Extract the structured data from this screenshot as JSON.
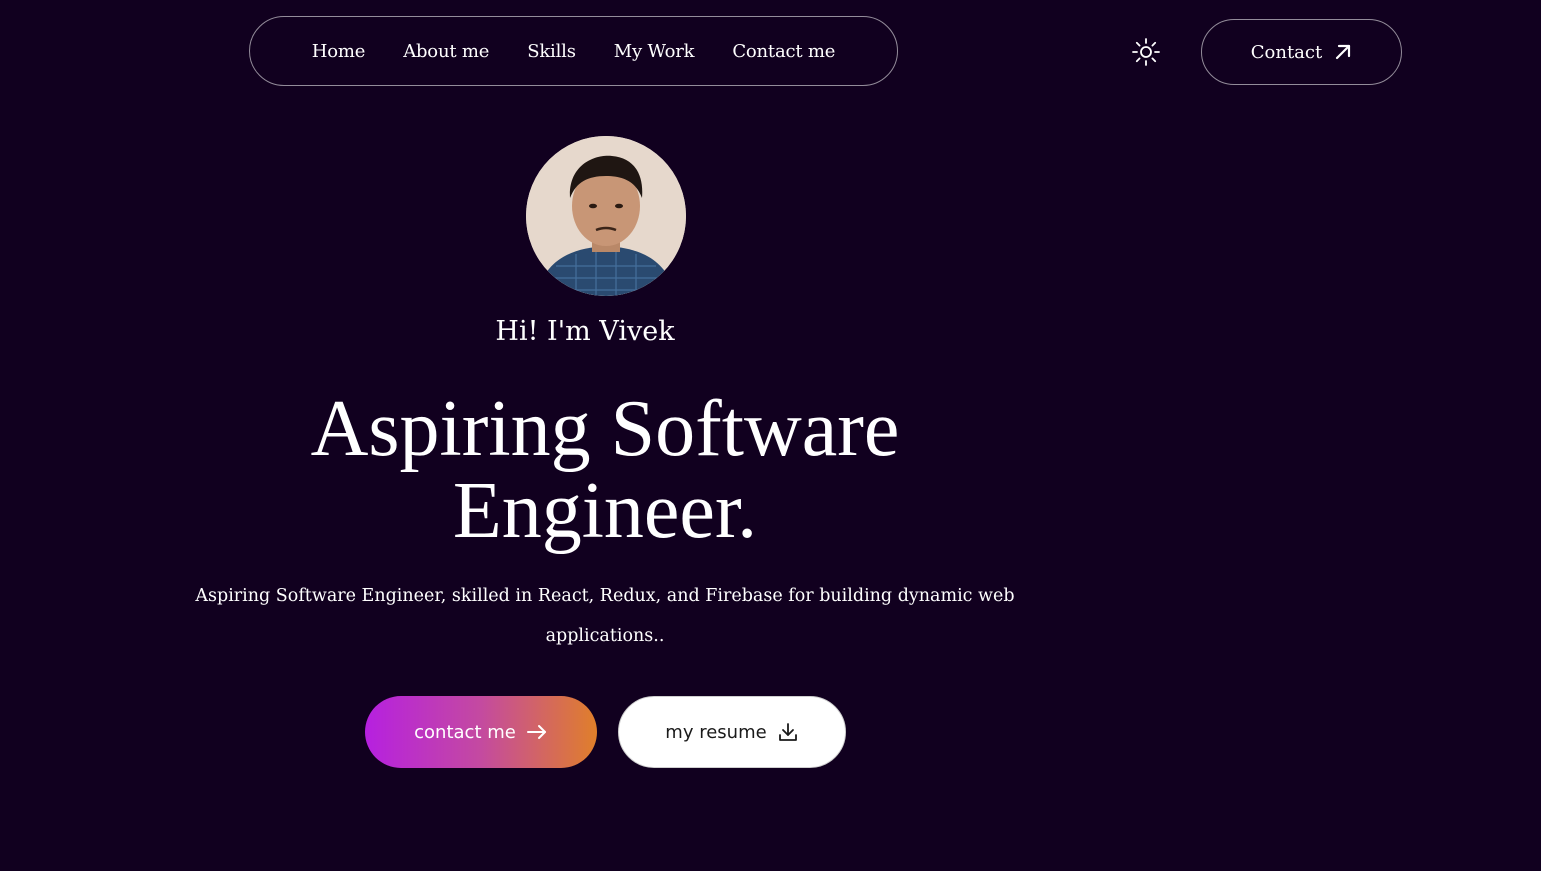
{
  "nav": {
    "items": [
      {
        "label": "Home"
      },
      {
        "label": "About me"
      },
      {
        "label": "Skills"
      },
      {
        "label": "My Work"
      },
      {
        "label": "Contact me"
      }
    ],
    "theme_toggle_icon": "sun-icon",
    "contact_label": "Contact",
    "contact_icon": "arrow-up-right-icon"
  },
  "hero": {
    "greeting": "Hi! I'm Vivek",
    "headline_line1": "Aspiring Software",
    "headline_line2": "Engineer.",
    "description": "Aspiring Software Engineer, skilled in React, Redux, and Firebase for building dynamic web applications..",
    "primary_button_label": "contact me",
    "primary_button_icon": "arrow-right-icon",
    "secondary_button_label": "my resume",
    "secondary_button_icon": "download-icon"
  },
  "colors": {
    "background": "#11001f",
    "gradient_start": "#b620e0",
    "gradient_end": "#e07f2a",
    "text": "#ffffff"
  }
}
